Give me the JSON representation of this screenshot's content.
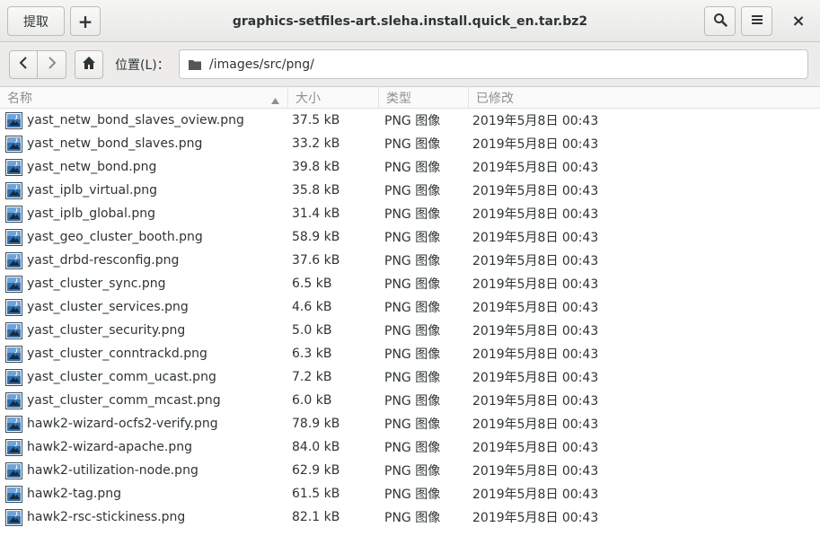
{
  "window": {
    "title": "graphics-setfiles-art.sleha.install.quick_en.tar.bz2",
    "extract_label": "提取",
    "add_label": "+",
    "menu_icon": "hamburger-menu-icon",
    "search_icon": "search-icon",
    "close_label": "×"
  },
  "location": {
    "label": "位置(L)：",
    "path": "/images/src/png/"
  },
  "columns": {
    "name": "名称",
    "size": "大小",
    "type": "类型",
    "modified": "已修改"
  },
  "files": [
    {
      "name": "yast_netw_bond_slaves_oview.png",
      "size": "37.5 kB",
      "type": "PNG 图像",
      "modified": "2019年5月8日 00:43"
    },
    {
      "name": "yast_netw_bond_slaves.png",
      "size": "33.2 kB",
      "type": "PNG 图像",
      "modified": "2019年5月8日 00:43"
    },
    {
      "name": "yast_netw_bond.png",
      "size": "39.8 kB",
      "type": "PNG 图像",
      "modified": "2019年5月8日 00:43"
    },
    {
      "name": "yast_iplb_virtual.png",
      "size": "35.8 kB",
      "type": "PNG 图像",
      "modified": "2019年5月8日 00:43"
    },
    {
      "name": "yast_iplb_global.png",
      "size": "31.4 kB",
      "type": "PNG 图像",
      "modified": "2019年5月8日 00:43"
    },
    {
      "name": "yast_geo_cluster_booth.png",
      "size": "58.9 kB",
      "type": "PNG 图像",
      "modified": "2019年5月8日 00:43"
    },
    {
      "name": "yast_drbd-resconfig.png",
      "size": "37.6 kB",
      "type": "PNG 图像",
      "modified": "2019年5月8日 00:43"
    },
    {
      "name": "yast_cluster_sync.png",
      "size": "6.5 kB",
      "type": "PNG 图像",
      "modified": "2019年5月8日 00:43"
    },
    {
      "name": "yast_cluster_services.png",
      "size": "4.6 kB",
      "type": "PNG 图像",
      "modified": "2019年5月8日 00:43"
    },
    {
      "name": "yast_cluster_security.png",
      "size": "5.0 kB",
      "type": "PNG 图像",
      "modified": "2019年5月8日 00:43"
    },
    {
      "name": "yast_cluster_conntrackd.png",
      "size": "6.3 kB",
      "type": "PNG 图像",
      "modified": "2019年5月8日 00:43"
    },
    {
      "name": "yast_cluster_comm_ucast.png",
      "size": "7.2 kB",
      "type": "PNG 图像",
      "modified": "2019年5月8日 00:43"
    },
    {
      "name": "yast_cluster_comm_mcast.png",
      "size": "6.0 kB",
      "type": "PNG 图像",
      "modified": "2019年5月8日 00:43"
    },
    {
      "name": "hawk2-wizard-ocfs2-verify.png",
      "size": "78.9 kB",
      "type": "PNG 图像",
      "modified": "2019年5月8日 00:43"
    },
    {
      "name": "hawk2-wizard-apache.png",
      "size": "84.0 kB",
      "type": "PNG 图像",
      "modified": "2019年5月8日 00:43"
    },
    {
      "name": "hawk2-utilization-node.png",
      "size": "62.9 kB",
      "type": "PNG 图像",
      "modified": "2019年5月8日 00:43"
    },
    {
      "name": "hawk2-tag.png",
      "size": "61.5 kB",
      "type": "PNG 图像",
      "modified": "2019年5月8日 00:43"
    },
    {
      "name": "hawk2-rsc-stickiness.png",
      "size": "82.1 kB",
      "type": "PNG 图像",
      "modified": "2019年5月8日 00:43"
    }
  ]
}
